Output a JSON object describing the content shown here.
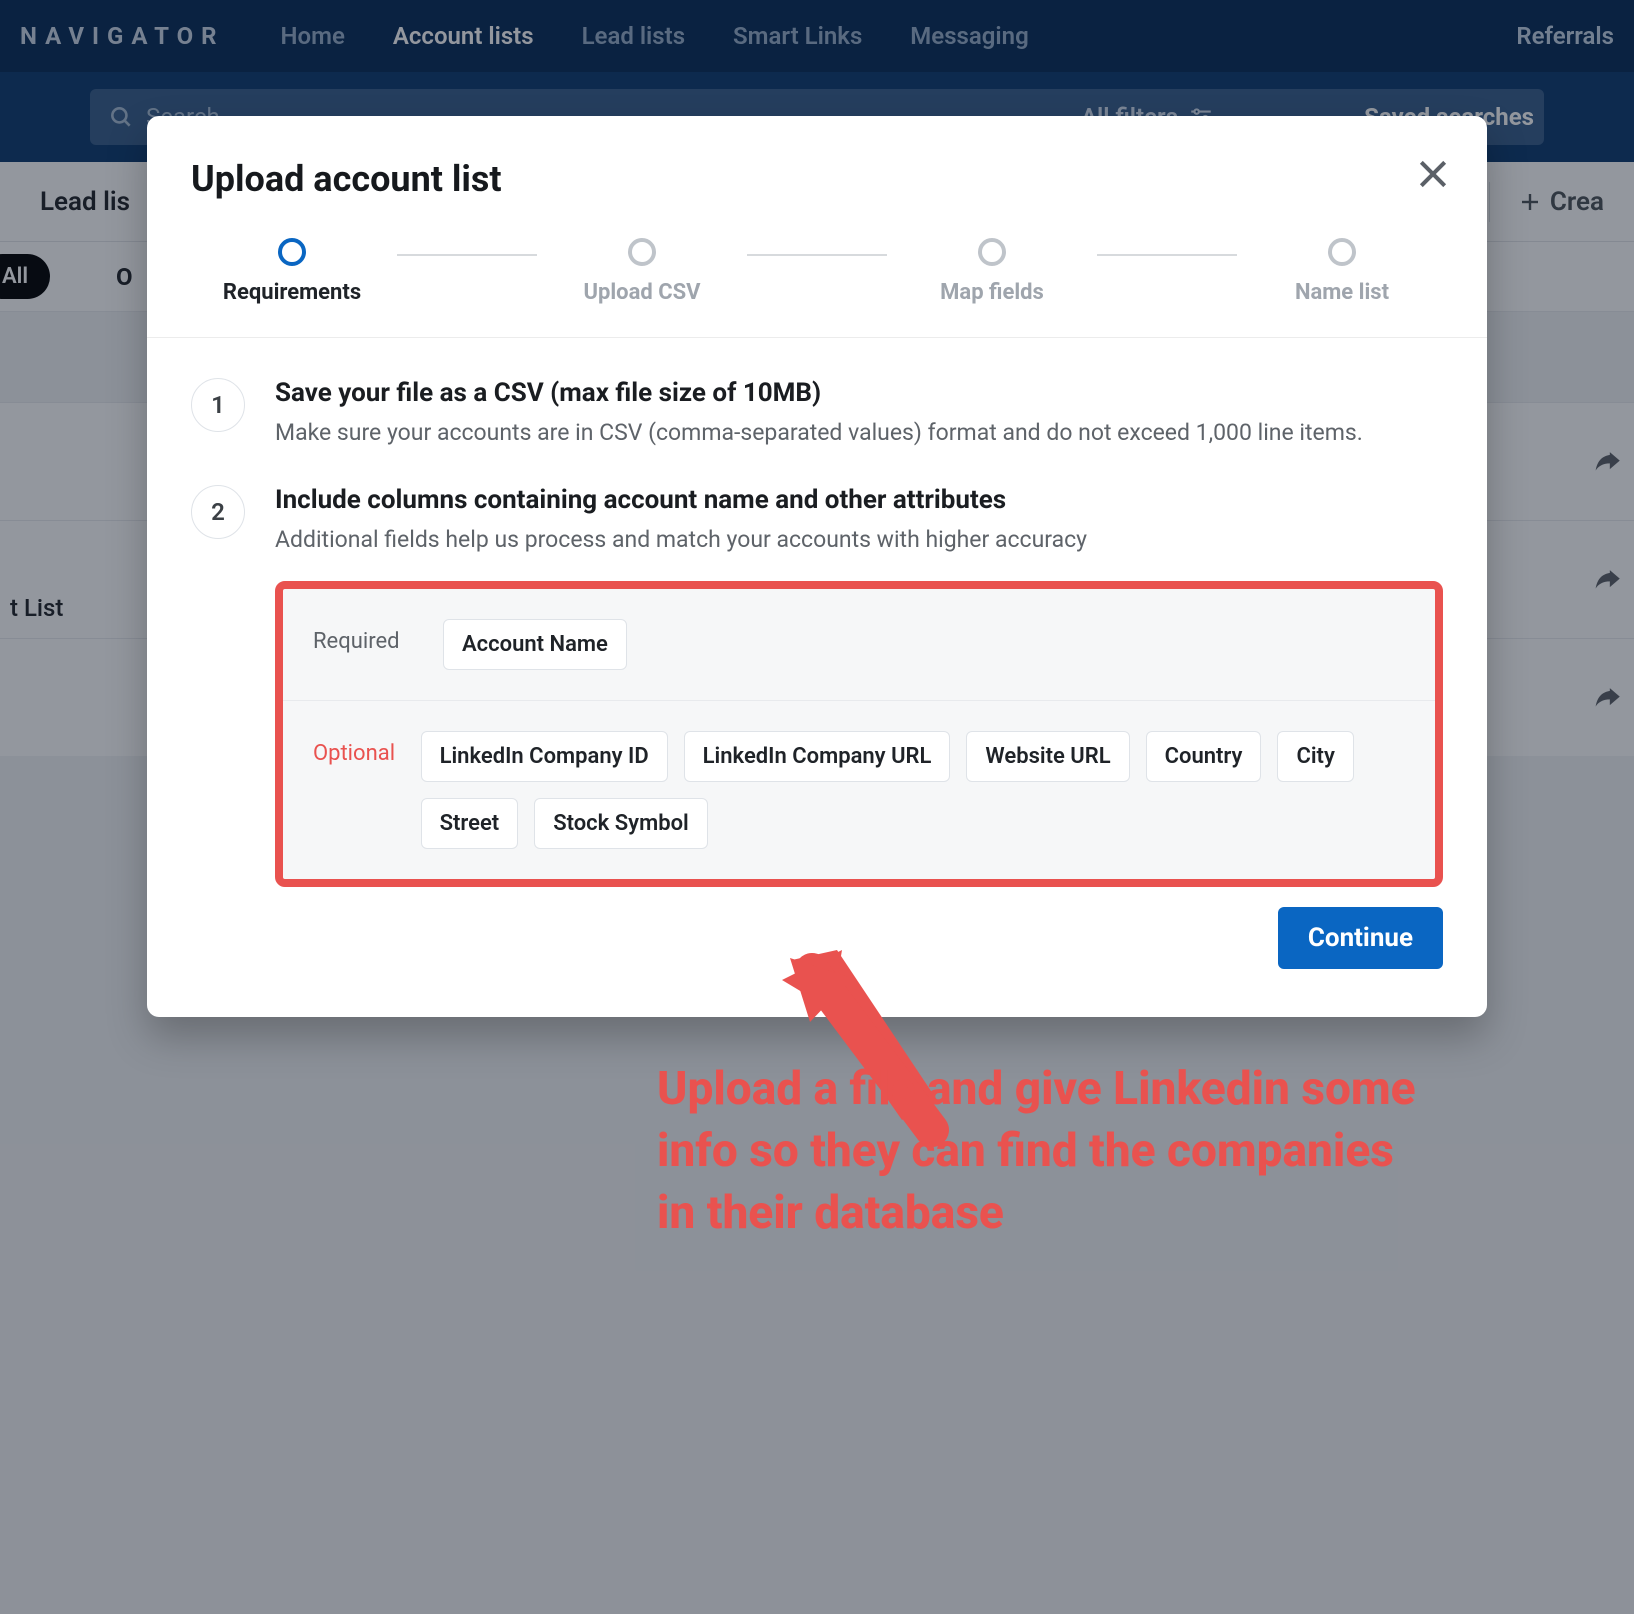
{
  "topnav": {
    "brand": "NAVIGATOR",
    "links": [
      "Home",
      "Account lists",
      "Lead lists",
      "Smart Links",
      "Messaging"
    ],
    "active_index": 1,
    "right": "Referrals"
  },
  "search": {
    "placeholder": "Search",
    "all_filters": "All filters",
    "saved_searches": "Saved searches"
  },
  "secondary": {
    "left": "Lead lis",
    "right_paren": ")",
    "create": "Crea"
  },
  "filters": {
    "pill_all": "All",
    "pill_o": "O"
  },
  "bg_list_label": "t List",
  "modal": {
    "title": "Upload account list",
    "steps": [
      "Requirements",
      "Upload CSV",
      "Map fields",
      "Name list"
    ],
    "active_step": 0,
    "items": [
      {
        "num": "1",
        "title": "Save your file as a CSV (max file size of 10MB)",
        "desc": "Make sure your accounts are in CSV (comma-separated values) format and do not exceed 1,000 line items."
      },
      {
        "num": "2",
        "title": "Include columns containing account name and other attributes",
        "desc": "Additional fields help us process and match your accounts with higher accuracy"
      }
    ],
    "required_label": "Required",
    "required_tags": [
      "Account Name"
    ],
    "optional_label": "Optional",
    "optional_tags": [
      "LinkedIn Company ID",
      "LinkedIn Company URL",
      "Website URL",
      "Country",
      "City",
      "Street",
      "Stock Symbol"
    ],
    "continue": "Continue"
  },
  "annotation": "Upload a file and give Linkedin some info so they can find the companies in their database"
}
